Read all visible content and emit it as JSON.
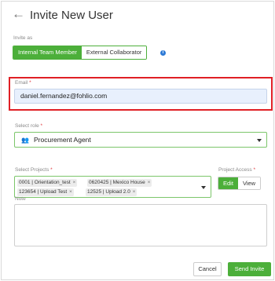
{
  "header": {
    "title": "Invite New User"
  },
  "invite_as": {
    "label": "Invite as",
    "options": [
      "Internal Team Member",
      "External Collaborator"
    ],
    "selected": "Internal Team Member"
  },
  "email": {
    "label": "Email",
    "required": "*",
    "value": "daniel.fernandez@fohlio.com"
  },
  "role": {
    "label": "Select role",
    "required": "*",
    "value": "Procurement Agent",
    "icon": "users-icon"
  },
  "projects": {
    "label": "Select Projects",
    "required": "*",
    "chips": [
      "0001 | Orientation_test",
      "0620425 | Mexico House",
      "123654 | Upload Test",
      "12525 | Upload 2.0"
    ],
    "remove_glyph": "×"
  },
  "access": {
    "label": "Project Access",
    "required": "*",
    "options": [
      "Edit",
      "View"
    ],
    "selected": "Edit"
  },
  "note": {
    "label": "Note",
    "value": ""
  },
  "actions": {
    "cancel": "Cancel",
    "send": "Send Invite"
  },
  "colors": {
    "accent": "#4caf3a",
    "highlight": "#e02025",
    "info": "#2d7ad6",
    "required": "#e0393e"
  }
}
